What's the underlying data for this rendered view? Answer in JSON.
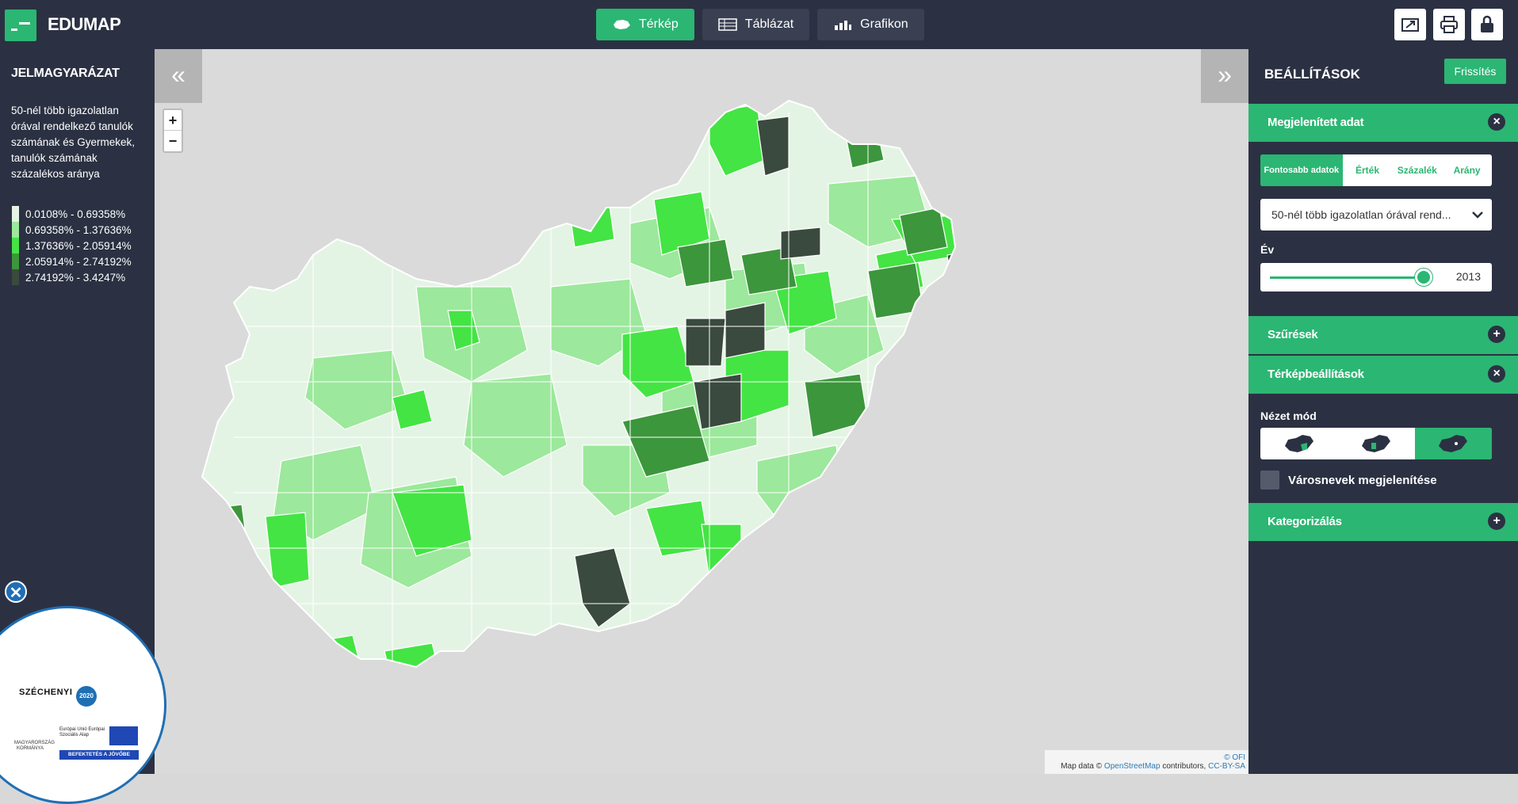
{
  "app": {
    "name": "EDUMAP"
  },
  "tabs": [
    {
      "label": "Térkép",
      "icon": "map-icon",
      "active": true
    },
    {
      "label": "Táblázat",
      "icon": "table-icon",
      "active": false
    },
    {
      "label": "Grafikon",
      "icon": "bar-chart-icon",
      "active": false
    }
  ],
  "toolbar": {
    "icons": [
      "export-icon",
      "print-icon",
      "lock-icon"
    ]
  },
  "legend": {
    "title": "JELMAGYARÁZAT",
    "description": "50-nél több igazolatlan órával rendelkező tanulók számának és Gyermekek, tanulók számának százalékos aránya",
    "items": [
      {
        "label": "0.0108% - 0.69358%",
        "color": "#e4f4e4"
      },
      {
        "label": "0.69358% - 1.37636%",
        "color": "#9ce89c"
      },
      {
        "label": "1.37636% - 2.05914%",
        "color": "#44e444"
      },
      {
        "label": "2.05914% - 2.74192%",
        "color": "#3c963c"
      },
      {
        "label": "2.74192% - 3.4247%",
        "color": "#3a4a3e"
      }
    ]
  },
  "map": {
    "zoom_in": "+",
    "zoom_out": "−",
    "collapse_left": "«",
    "collapse_right": "»",
    "attribution_ofi": "© OFI",
    "attribution_prefix": "Map data ©",
    "attribution_osm": "OpenStreetMap",
    "attribution_mid": "contributors,",
    "attribution_license": "CC-BY-SA"
  },
  "settings": {
    "title": "BEÁLLÍTÁSOK",
    "refresh_label": "Frissítés",
    "sections": {
      "displayed_data": "Megjelenített adat",
      "filters": "Szűrések",
      "map_settings": "Térképbeállítások",
      "categorization": "Kategorizálás"
    },
    "subtabs": [
      {
        "label": "Fontosabb adatok",
        "active": true
      },
      {
        "label": "Érték",
        "active": false
      },
      {
        "label": "Százalék",
        "active": false
      },
      {
        "label": "Arány",
        "active": false
      }
    ],
    "selected_indicator": "50-nél több igazolatlan órával rend...",
    "year_label": "Év",
    "year_value": "2013",
    "year_slider_position": 0.97,
    "view_mode_label": "Nézet mód",
    "view_modes": [
      "hungary-map-icon",
      "hungary-map-icon",
      "hungary-map-icon"
    ],
    "show_city_names_label": "Városnevek megjelenítése",
    "show_city_names": false
  },
  "footer_badge": {
    "close": "✕",
    "program": "SZÉCHENYI",
    "program_year": "2020",
    "gov": "MAGYARORSZÁG KORMÁNYA",
    "eu": "Európai Unió Európai Szociális Alap",
    "slogan": "BEFEKTETÉS A JÖVŐBE"
  },
  "colors": {
    "accent": "#2bb673",
    "panel": "#2b3142"
  }
}
